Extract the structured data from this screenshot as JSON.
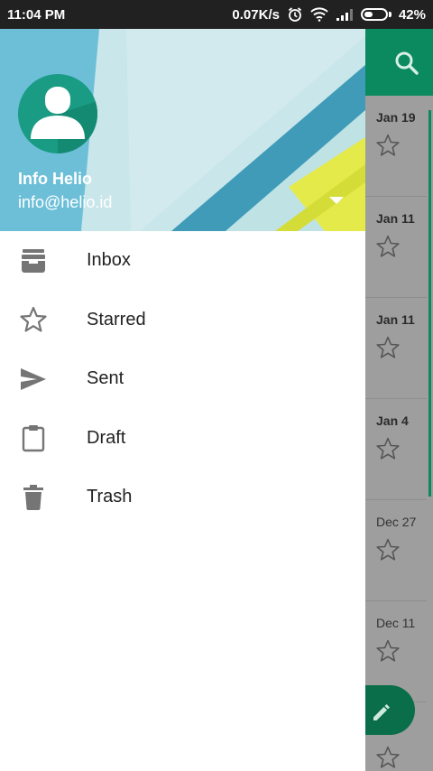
{
  "status_bar": {
    "time": "11:04 PM",
    "speed": "0.07K/s",
    "battery": "42%",
    "battery_level": 0.42,
    "icons": [
      "alarm-icon",
      "wifi-icon",
      "signal-icon",
      "battery-icon"
    ]
  },
  "drawer": {
    "account": {
      "name": "Info Helio",
      "email": "info@helio.id"
    },
    "items": [
      {
        "label": "Inbox",
        "icon": "inbox-icon"
      },
      {
        "label": "Starred",
        "icon": "star-icon"
      },
      {
        "label": "Sent",
        "icon": "send-icon"
      },
      {
        "label": "Draft",
        "icon": "clipboard-icon"
      },
      {
        "label": "Trash",
        "icon": "trash-icon"
      }
    ]
  },
  "background_list": {
    "rows": [
      {
        "date": "Jan 19",
        "unread": true
      },
      {
        "date": "Jan 11",
        "unread": true
      },
      {
        "date": "Jan 11",
        "unread": true
      },
      {
        "date": "Jan 4",
        "unread": true
      },
      {
        "date": "Dec 27",
        "unread": false
      },
      {
        "date": "Dec 11",
        "unread": false
      }
    ]
  },
  "colors": {
    "accent": "#0b8a5f",
    "status_bar": "#212121",
    "avatar": "#1a9c84"
  }
}
